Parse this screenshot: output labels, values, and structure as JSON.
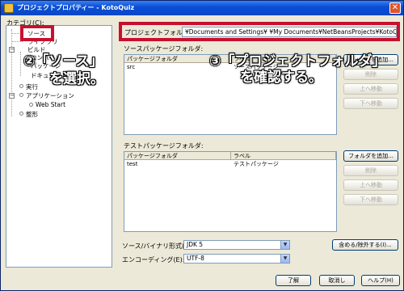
{
  "window": {
    "title": "プロジェクトプロパティー - KotoQuiz",
    "close_glyph": "✕"
  },
  "category": {
    "label": "カテゴリ(C):",
    "items": {
      "source": "ソース",
      "libraries": "ライブラリ",
      "build": "ビルド",
      "compile": "コンパイル",
      "package": "パッケージ",
      "javadoc": "ドキュメント化",
      "run": "実行",
      "application": "アプリケーション",
      "webstart": "Web Start",
      "formatting": "整形"
    }
  },
  "project_folder": {
    "label": "プロジェクトフォルダ:",
    "value": "¥Documents and Settings¥            ¥My Documents¥NetBeansProjects¥KotoQuiz"
  },
  "source_packages": {
    "label": "ソースパッケージフォルダ:",
    "columns": [
      "パッケージフォルダ",
      "ラベル"
    ],
    "rows": [
      [
        "src",
        "ソースパッケージ"
      ]
    ],
    "buttons": {
      "add": "フォルダを追加...",
      "remove": "削除",
      "up": "上へ移動",
      "down": "下へ移動"
    }
  },
  "test_packages": {
    "label": "テストパッケージフォルダ:",
    "columns": [
      "パッケージフォルダ",
      "ラベル"
    ],
    "rows": [
      [
        "test",
        "テストパッケージ"
      ]
    ],
    "buttons": {
      "add": "フォルダを追加...",
      "remove": "削除",
      "up": "上へ移動",
      "down": "下へ移動"
    }
  },
  "source_format": {
    "label": "ソース/バイナリ形式(B):",
    "value": "JDK 5"
  },
  "encoding": {
    "label": "エンコーディング(E):",
    "value": "UTF-8"
  },
  "include_exclude_button": "含める/除外する(I)...",
  "footer": {
    "ok": "了解",
    "cancel": "取消し",
    "help": "ヘルプ(H)"
  },
  "annotations": {
    "step2_line1": "②「ソース」",
    "step2_line2": "を選択。",
    "step3_line1": "③「プロジェクトフォルダ」",
    "step3_line2": "を確認する。"
  },
  "colors": {
    "highlight_red": "#c8102e",
    "title_blue": "#0a46c8",
    "dialog_bg": "#ece9d8"
  }
}
